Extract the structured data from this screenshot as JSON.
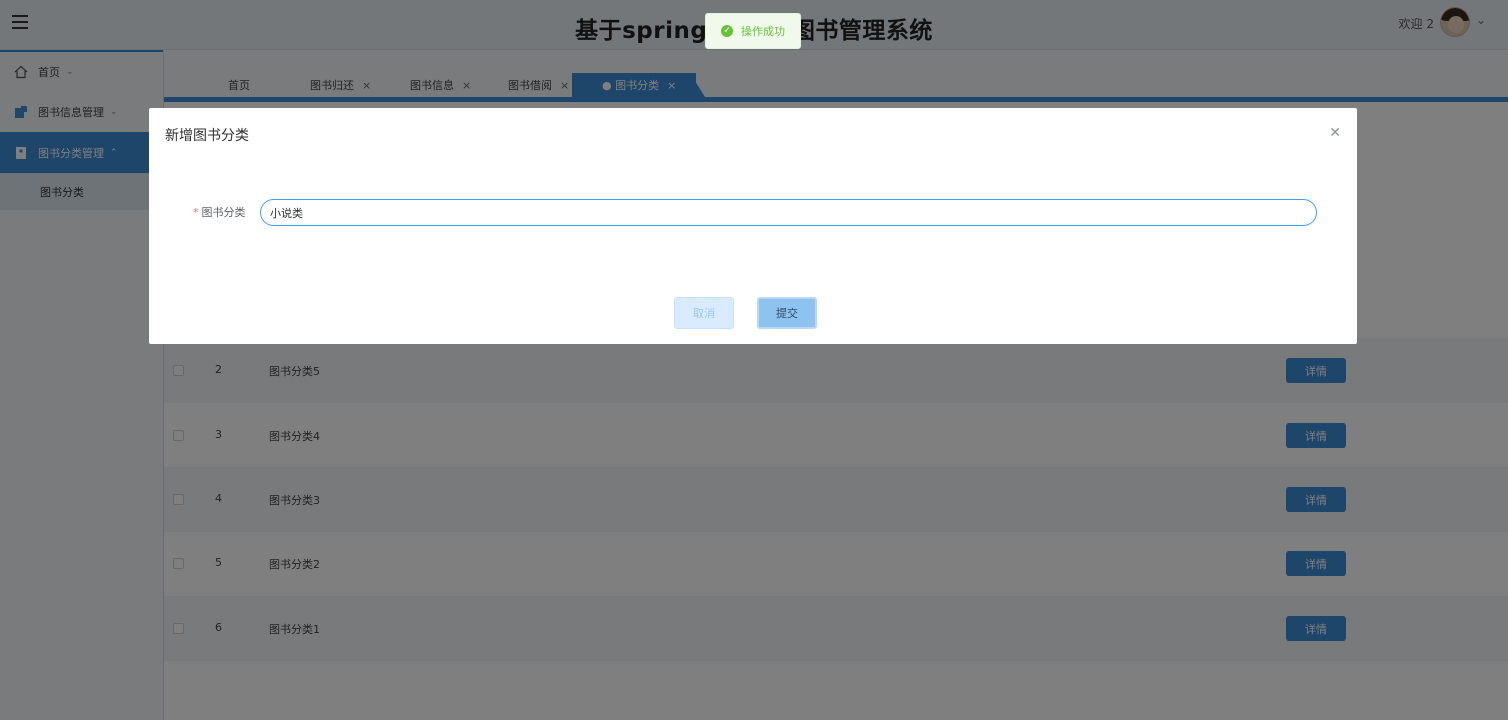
{
  "header": {
    "title": "基于springboot的图书管理系统",
    "welcome": "欢迎 2",
    "chevron": "⌄"
  },
  "toast": {
    "message": "操作成功",
    "icon": "check-circle-icon",
    "color": "#67c23a"
  },
  "sidebar": {
    "items": [
      {
        "label": "首页",
        "icon": "home-icon"
      },
      {
        "label": "图书信息管理",
        "icon": "book-icon"
      },
      {
        "label": "图书分类管理",
        "icon": "category-icon"
      }
    ],
    "submenu": [
      {
        "label": "图书分类"
      }
    ]
  },
  "tabs": [
    {
      "label": "首页"
    },
    {
      "label": "图书归还"
    },
    {
      "label": "图书信息"
    },
    {
      "label": "图书借阅"
    },
    {
      "label": "● 图书分类"
    }
  ],
  "table": {
    "rows": [
      {
        "index": "2",
        "name": "图书分类5",
        "action": "详情"
      },
      {
        "index": "3",
        "name": "图书分类4",
        "action": "详情"
      },
      {
        "index": "4",
        "name": "图书分类3",
        "action": "详情"
      },
      {
        "index": "5",
        "name": "图书分类2",
        "action": "详情"
      },
      {
        "index": "6",
        "name": "图书分类1",
        "action": "详情"
      }
    ]
  },
  "dialog": {
    "title": "新增图书分类",
    "field_label": "图书分类",
    "required_mark": "*",
    "field_value": "小说类",
    "cancel_label": "取消",
    "submit_label": "提交"
  },
  "colors": {
    "primary": "#3d8bd4",
    "success": "#67c23a"
  }
}
